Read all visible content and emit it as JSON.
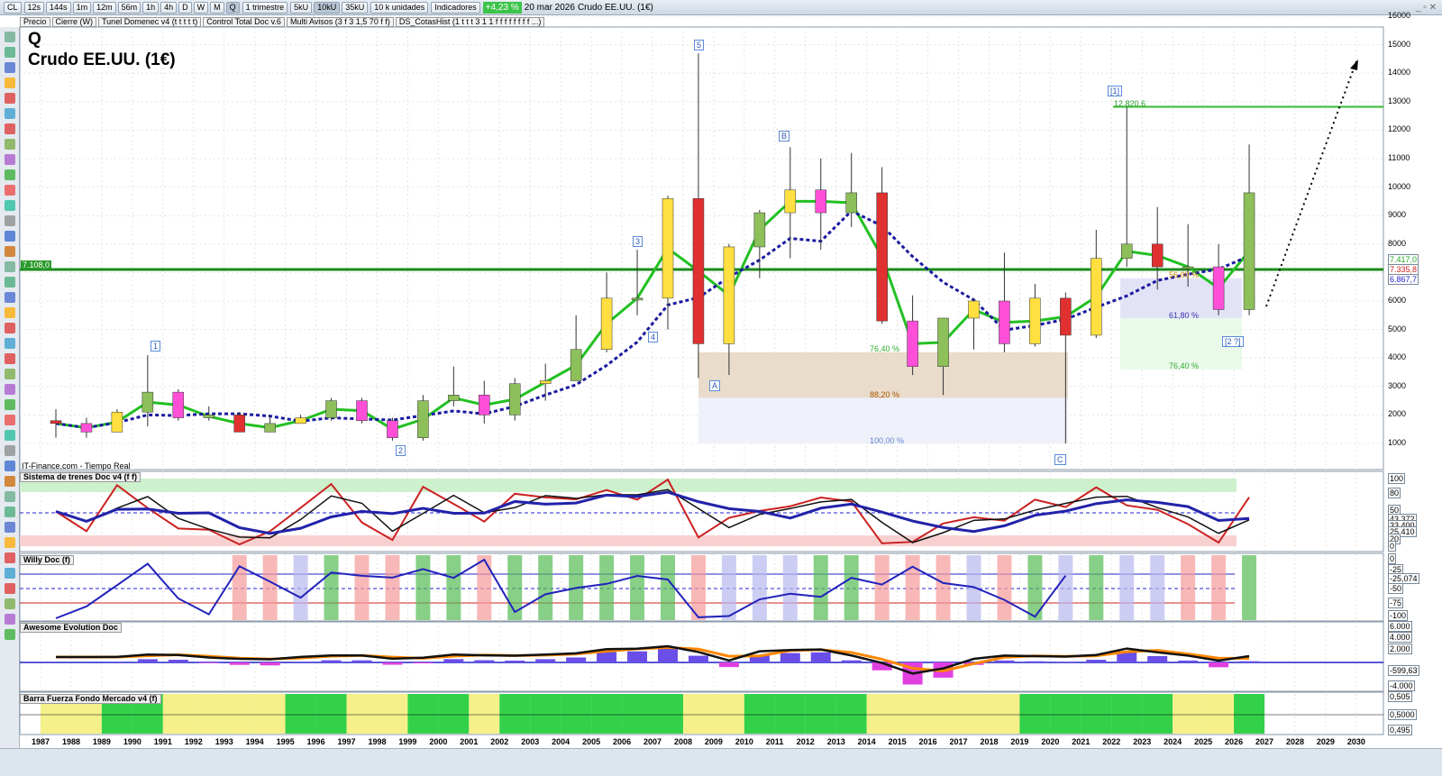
{
  "toolbar": {
    "symbol": "CL",
    "timeframes": [
      "12s",
      "144s",
      "1m",
      "12m",
      "56m",
      "1h",
      "4h",
      "D",
      "W",
      "M",
      "Q"
    ],
    "active_timeframe": "Q",
    "period": "1 trimestre",
    "units_buttons": [
      "5kU",
      "10kU",
      "35kU"
    ],
    "active_units": "10kU",
    "units": "10 k unidades",
    "indicators": "Indicadores",
    "change": "+4,23 %",
    "date": "20 mar 2026",
    "instrument": "Crudo EE.UU. (1€)"
  },
  "indicator_bar": [
    "Precio",
    "Cierre (W)",
    "Tunel Domenec v4 (t t t t t)",
    "Control Total Doc v.6",
    "Multi Avisos (3 f 3 1,5 70 f f)",
    "DS_CotasHist (1 t t t 3 1 1 f f f f f f f f ...)"
  ],
  "header": {
    "letter": "Q",
    "title": "Crudo EE.UU. (1€)",
    "source": "IT-Finance.com - Tiempo Real"
  },
  "panels": [
    "Sistema de trenes Doc v4 (f f)",
    "Willy Doc (f)",
    "Awesome Evolution Doc",
    "Barra Fuerza Fondo Mercado v4 (f)"
  ],
  "annotations": {
    "waves": [
      "1",
      "2",
      "3",
      "4",
      "5",
      "A",
      "B",
      "C",
      "[1]",
      "[2 ?]"
    ],
    "fib": [
      "76,40 %",
      "88,20 %",
      "100,00 %",
      "61,80 %",
      "76,40 %",
      "56,00 %"
    ],
    "level_left": "7.108,0",
    "level_high": "12.820,6"
  },
  "price_tags": {
    "green": "7.417,0",
    "red": "7.335,8",
    "blue": "6.867,7"
  },
  "panel_axes": {
    "p1": [
      "100",
      "80",
      "50",
      "43,372",
      "33,400",
      "25,410",
      "20",
      "0"
    ],
    "p2": [
      "0",
      "-25",
      "-25,074",
      "-50",
      "-75",
      "-100"
    ],
    "p3": [
      "6.000",
      "4.000",
      "2.000",
      "-599,63",
      "-4.000"
    ],
    "p4": [
      "0,505",
      "0,5000",
      "0,495"
    ]
  },
  "colors": {
    "up": "#8dbf5a",
    "down": "#e03030",
    "ma_fast": "#22c022",
    "ma_slow": "#1a1aa0",
    "level": "#1a8a1a"
  },
  "chart_data": {
    "type": "candlestick",
    "title": "Crudo EE.UU. (1€)",
    "timeframe": "Q",
    "ylim": [
      0,
      16000
    ],
    "yticks": [
      1000,
      2000,
      3000,
      4000,
      5000,
      6000,
      7000,
      8000,
      9000,
      10000,
      11000,
      12000,
      13000,
      14000,
      15000,
      16000
    ],
    "x": [
      1987,
      1988,
      1989,
      1990,
      1991,
      1992,
      1993,
      1994,
      1995,
      1996,
      1997,
      1998,
      1999,
      2000,
      2001,
      2002,
      2003,
      2004,
      2005,
      2006,
      2007,
      2008,
      2009,
      2010,
      2011,
      2012,
      2013,
      2014,
      2015,
      2016,
      2017,
      2018,
      2019,
      2020,
      2021,
      2022,
      2023,
      2024,
      2025,
      2026
    ],
    "open": [
      1800,
      1700,
      1400,
      2100,
      2800,
      1900,
      2000,
      1400,
      1700,
      1900,
      2500,
      1800,
      1200,
      2500,
      2700,
      2000,
      3100,
      3200,
      4300,
      6100,
      6100,
      9600,
      4500,
      7900,
      9100,
      9900,
      9100,
      9800,
      5300,
      3700,
      5400,
      6000,
      4500,
      6100,
      4800,
      7500,
      8000,
      7200,
      7200,
      5700
    ],
    "high": [
      2200,
      1900,
      2200,
      4100,
      2900,
      2300,
      2100,
      2000,
      2000,
      2600,
      2600,
      1900,
      2700,
      3700,
      3200,
      3300,
      3800,
      5500,
      7000,
      7800,
      9700,
      14700,
      8000,
      9200,
      11400,
      11000,
      11200,
      10700,
      6200,
      5400,
      6100,
      7700,
      6600,
      6300,
      8500,
      12800,
      9300,
      8700,
      8000,
      11500
    ],
    "low": [
      1200,
      1200,
      1400,
      1600,
      1800,
      1800,
      1400,
      1400,
      1700,
      1800,
      1700,
      1100,
      1100,
      2300,
      1700,
      1800,
      2500,
      3200,
      4200,
      5500,
      5000,
      3300,
      3400,
      6800,
      7500,
      7800,
      8600,
      5200,
      3400,
      2700,
      4300,
      4200,
      4400,
      1000,
      4700,
      7200,
      6400,
      6500,
      5500,
      5500
    ],
    "close": [
      1700,
      1400,
      2100,
      2800,
      1900,
      2000,
      1400,
      1700,
      1900,
      2500,
      1800,
      1200,
      2500,
      2700,
      2000,
      3100,
      3200,
      4300,
      6100,
      6100,
      9600,
      4500,
      7900,
      9100,
      9900,
      9100,
      9800,
      5300,
      3700,
      5400,
      6000,
      4500,
      6100,
      4800,
      7500,
      8000,
      7200,
      7200,
      5700,
      9800
    ]
  }
}
